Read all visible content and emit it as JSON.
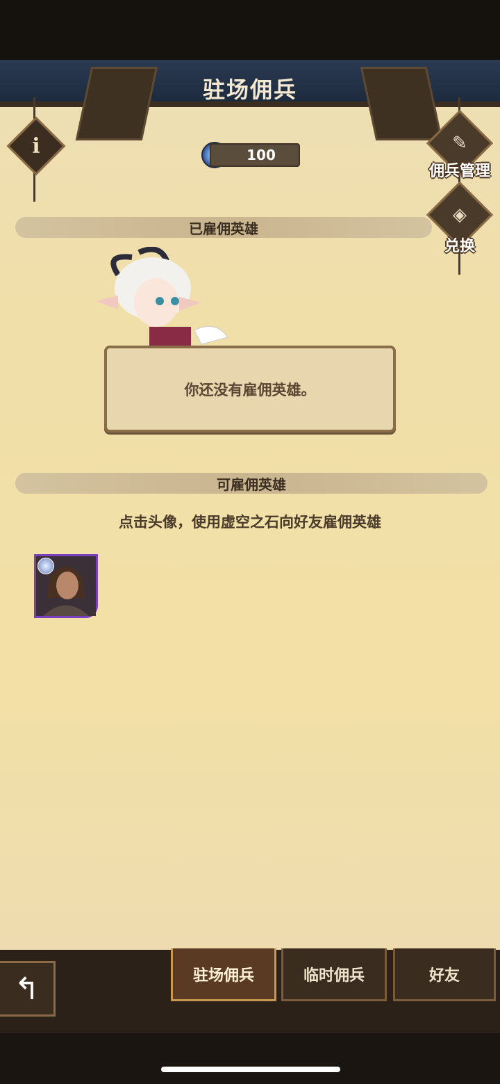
{
  "header": {
    "title": "驻场佣兵"
  },
  "currency": {
    "amount": "100",
    "icon": "void-stone-icon"
  },
  "side_buttons": [
    {
      "label": "佣兵管理",
      "icon": "quill-scroll-icon"
    },
    {
      "label": "兑换",
      "icon": "crystal-icon"
    }
  ],
  "sections": {
    "hired": {
      "title": "已雇佣英雄",
      "empty_message": "你还没有雇佣英雄。"
    },
    "available": {
      "title": "可雇佣英雄",
      "hint": "点击头像，使用虚空之石向好友雇佣英雄",
      "heroes": [
        {
          "icon": "hero-portrait"
        }
      ]
    }
  },
  "tabs": [
    {
      "label": "驻场佣兵",
      "active": true
    },
    {
      "label": "临时佣兵",
      "active": false
    },
    {
      "label": "好友",
      "active": false
    }
  ]
}
